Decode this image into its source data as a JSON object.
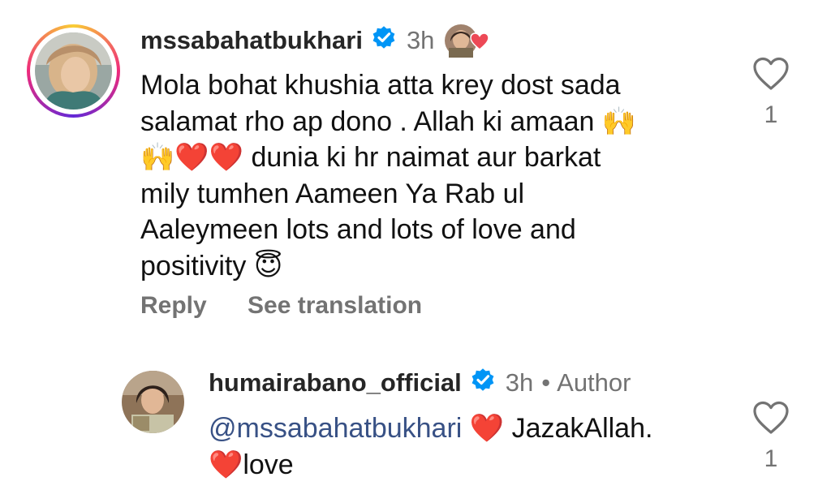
{
  "comments": [
    {
      "username": "mssabahatbukhari",
      "time": "3h",
      "lines": [
        "Mola bohat khushia atta krey dost sada",
        "salamat rho ap dono . Allah ki amaan 🙌",
        "🙌❤️❤️ dunia ki hr naimat aur barkat",
        "mily tumhen Aameen Ya Rab ul",
        "Aaleymeen lots and lots of love and",
        "positivity 😇"
      ],
      "actions": {
        "reply": "Reply",
        "translate": "See translation"
      },
      "like_count": "1"
    },
    {
      "username": "humairabano_official",
      "time": "3h",
      "dot": "•",
      "author_label": "Author",
      "mention": "@mssabahatbukhari",
      "line1_rest": " ❤️ JazakAllah.",
      "line2": "❤️love",
      "like_count": "1"
    }
  ],
  "colors": {
    "verified_blue": "#0095f6",
    "heart_red": "#ed4956",
    "secondary_gray": "#737373"
  },
  "icons": {
    "verified": "verified-badge-icon",
    "like": "heart-outline-icon",
    "liked_by_author": "author-liked-heart-icon"
  }
}
